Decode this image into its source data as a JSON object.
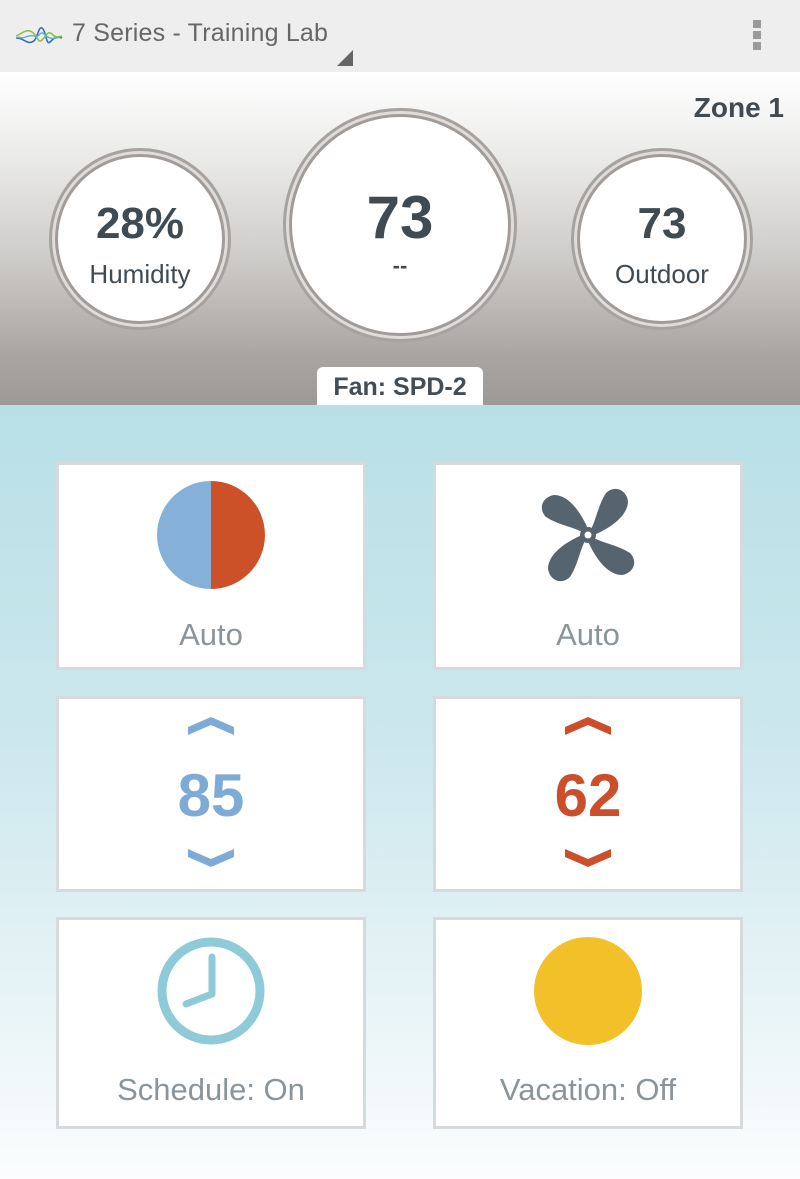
{
  "appbar": {
    "logo": "wave-logo-icon",
    "title": "7 Series - Training Lab",
    "menu_icon": "overflow-menu-icon"
  },
  "hero": {
    "zone": "Zone 1",
    "humidity": {
      "value": "28%",
      "label": "Humidity"
    },
    "indoor": {
      "value": "73",
      "label": "--"
    },
    "outdoor": {
      "value": "73",
      "label": "Outdoor"
    },
    "fan_status": "Fan: SPD-2"
  },
  "controls": {
    "mode": {
      "icon": "auto-mode-half-circle-icon",
      "label": "Auto",
      "colors": {
        "cool": "#85b0d8",
        "heat": "#cc5128"
      }
    },
    "fan": {
      "icon": "fan-icon",
      "label": "Auto",
      "color": "#56646f"
    },
    "cool_setpoint": {
      "value": "85",
      "color": "#7eaad6",
      "up_icon": "chevron-up-icon",
      "down_icon": "chevron-down-icon"
    },
    "heat_setpoint": {
      "value": "62",
      "color": "#cb4f2b",
      "up_icon": "chevron-up-icon",
      "down_icon": "chevron-down-icon"
    },
    "schedule": {
      "icon": "clock-icon",
      "label": "Schedule: On",
      "color": "#8fcad9"
    },
    "vacation": {
      "icon": "sun-circle-icon",
      "label": "Vacation: Off",
      "color": "#f2c12a"
    }
  }
}
